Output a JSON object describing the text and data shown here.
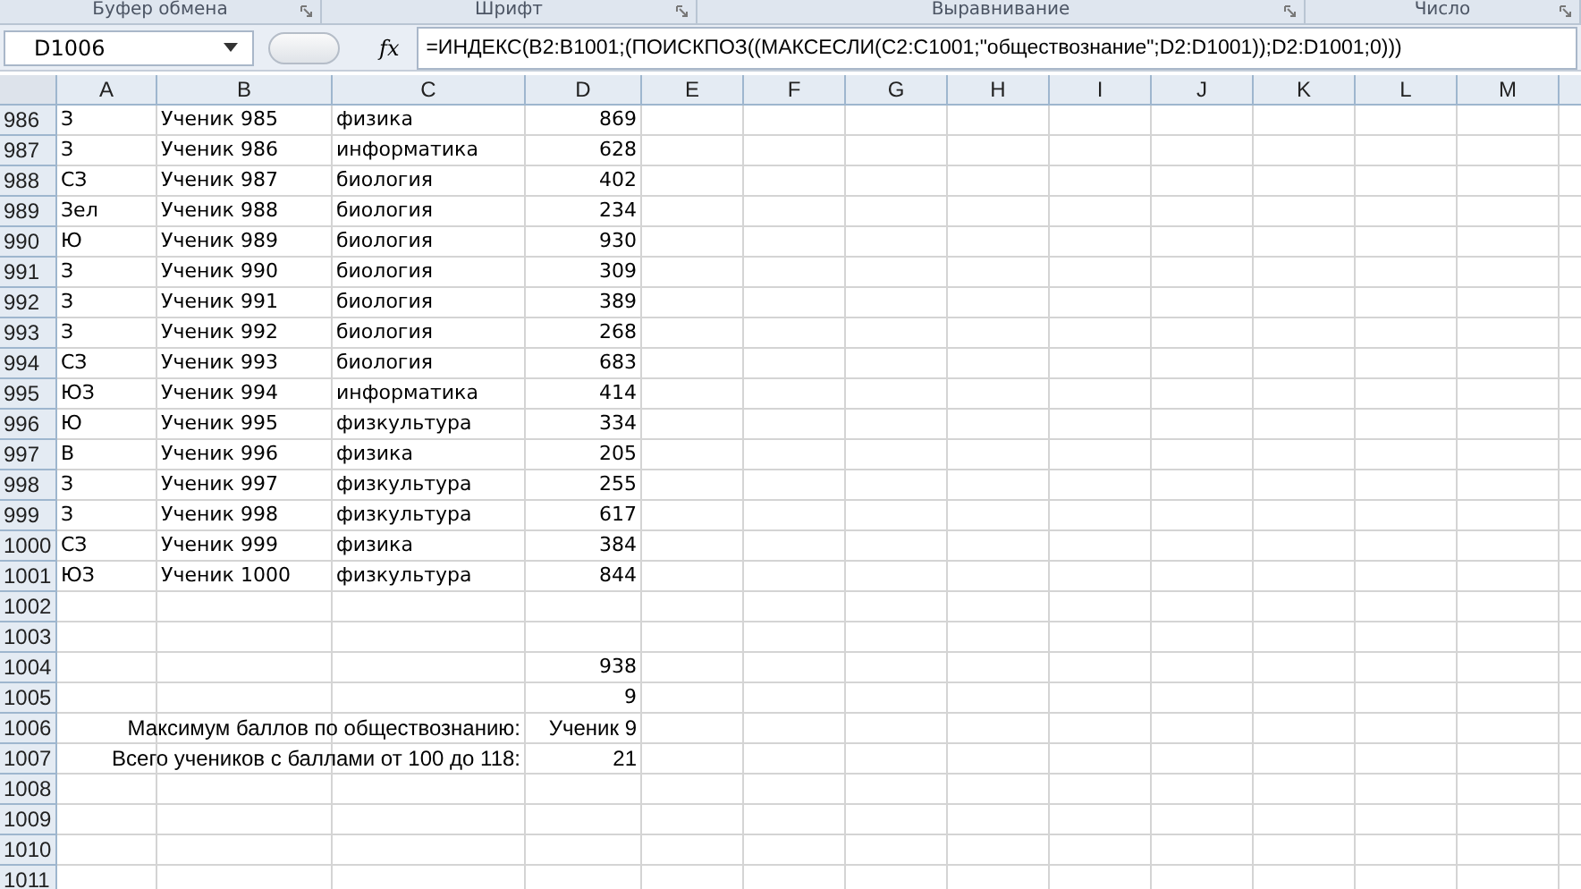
{
  "ribbon_groups": [
    "Буфер обмена",
    "Шрифт",
    "Выравнивание",
    "Число"
  ],
  "formula_bar": {
    "name_box": "D1006",
    "fx": "fx",
    "formula": "=ИНДЕКС(B2:B1001;(ПОИСКПОЗ((МАКСЕСЛИ(C2:C1001;\"обществознание\";D2:D1001));D2:D1001;0)))"
  },
  "columns": [
    "A",
    "B",
    "C",
    "D",
    "E",
    "F",
    "G",
    "H",
    "I",
    "J",
    "K",
    "L",
    "M"
  ],
  "rows": [
    {
      "number": "986",
      "kind": "data",
      "a": "З",
      "b": "Ученик 985",
      "c": "физика",
      "d": "869"
    },
    {
      "number": "987",
      "kind": "data",
      "a": "З",
      "b": "Ученик 986",
      "c": "информатика",
      "d": "628"
    },
    {
      "number": "988",
      "kind": "data",
      "a": "СЗ",
      "b": "Ученик 987",
      "c": "биология",
      "d": "402"
    },
    {
      "number": "989",
      "kind": "data",
      "a": "Зел",
      "b": "Ученик 988",
      "c": "биология",
      "d": "234"
    },
    {
      "number": "990",
      "kind": "data",
      "a": "Ю",
      "b": "Ученик 989",
      "c": "биология",
      "d": "930"
    },
    {
      "number": "991",
      "kind": "data",
      "a": "З",
      "b": "Ученик 990",
      "c": "биология",
      "d": "309"
    },
    {
      "number": "992",
      "kind": "data",
      "a": "З",
      "b": "Ученик 991",
      "c": "биология",
      "d": "389"
    },
    {
      "number": "993",
      "kind": "data",
      "a": "З",
      "b": "Ученик 992",
      "c": "биология",
      "d": "268"
    },
    {
      "number": "994",
      "kind": "data",
      "a": "СЗ",
      "b": "Ученик 993",
      "c": "биология",
      "d": "683"
    },
    {
      "number": "995",
      "kind": "data",
      "a": "ЮЗ",
      "b": "Ученик 994",
      "c": "информатика",
      "d": "414"
    },
    {
      "number": "996",
      "kind": "data",
      "a": "Ю",
      "b": "Ученик 995",
      "c": "физкультура",
      "d": "334"
    },
    {
      "number": "997",
      "kind": "data",
      "a": "В",
      "b": "Ученик 996",
      "c": "физика",
      "d": "205"
    },
    {
      "number": "998",
      "kind": "data",
      "a": "З",
      "b": "Ученик 997",
      "c": "физкультура",
      "d": "255"
    },
    {
      "number": "999",
      "kind": "data",
      "a": "З",
      "b": "Ученик 998",
      "c": "физкультура",
      "d": "617"
    },
    {
      "number": "1000",
      "kind": "data",
      "a": "СЗ",
      "b": "Ученик 999",
      "c": "физика",
      "d": "384"
    },
    {
      "number": "1001",
      "kind": "data",
      "a": "ЮЗ",
      "b": "Ученик 1000",
      "c": "физкультура",
      "d": "844"
    },
    {
      "number": "1002",
      "kind": "empty"
    },
    {
      "number": "1003",
      "kind": "empty"
    },
    {
      "number": "1004",
      "kind": "value",
      "d": "938"
    },
    {
      "number": "1005",
      "kind": "value",
      "d": "9"
    },
    {
      "number": "1006",
      "kind": "label",
      "label": "Максимум баллов по обществознанию:",
      "d": "Ученик 9"
    },
    {
      "number": "1007",
      "kind": "label",
      "label": "Всего учеников с баллами от 100 до 118:",
      "d": "21"
    },
    {
      "number": "1008",
      "kind": "empty"
    },
    {
      "number": "1009",
      "kind": "empty"
    },
    {
      "number": "1010",
      "kind": "empty"
    },
    {
      "number": "1011",
      "kind": "empty"
    }
  ]
}
